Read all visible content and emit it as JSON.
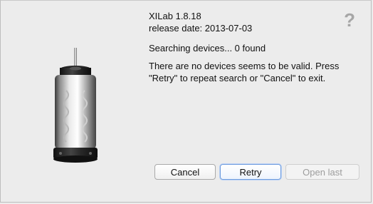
{
  "app": {
    "version_line": "XILab 1.8.18",
    "release_line": "release date: 2013-07-03"
  },
  "help": {
    "glyph": "?"
  },
  "status": {
    "searching": "Searching devices... 0 found",
    "message": "There are no devices seems to be valid. Press \"Retry\" to repeat search or \"Cancel\" to exit."
  },
  "buttons": {
    "cancel": "Cancel",
    "retry": "Retry",
    "open_last": "Open last"
  },
  "icons": {
    "motor": "stepper-motor-icon",
    "help": "question-mark-icon"
  },
  "colors": {
    "background": "#ececec",
    "default_button_border": "#6e9cde",
    "disabled_text": "#9d9d9d"
  }
}
